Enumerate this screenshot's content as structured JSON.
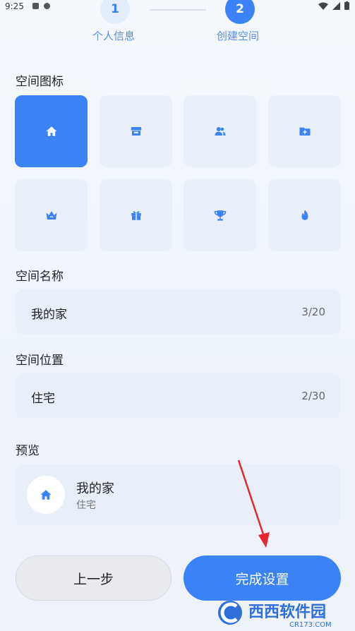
{
  "status_bar": {
    "time": "9:25"
  },
  "stepper": {
    "step1": {
      "number": "1",
      "label": "个人信息"
    },
    "step2": {
      "number": "2",
      "label": "创建空间"
    }
  },
  "icon_section": {
    "title": "空间图标",
    "icons": [
      {
        "name": "home-icon",
        "selected": true
      },
      {
        "name": "store-icon",
        "selected": false
      },
      {
        "name": "people-icon",
        "selected": false
      },
      {
        "name": "folder-add-icon",
        "selected": false
      },
      {
        "name": "crown-icon",
        "selected": false
      },
      {
        "name": "gift-icon",
        "selected": false
      },
      {
        "name": "trophy-icon",
        "selected": false
      },
      {
        "name": "fire-icon",
        "selected": false
      }
    ]
  },
  "name_section": {
    "title": "空间名称",
    "value": "我的家",
    "count": "3/20"
  },
  "location_section": {
    "title": "空间位置",
    "value": "住宅",
    "count": "2/30"
  },
  "preview": {
    "title": "预览",
    "name": "我的家",
    "location": "住宅"
  },
  "buttons": {
    "prev": "上一步",
    "done": "完成设置"
  },
  "colors": {
    "accent": "#3b82f6",
    "tile_bg": "#e9eff9",
    "annotation": "#e8262b"
  },
  "watermark": {
    "text": "西西软件园",
    "url": "CR173.COM"
  }
}
